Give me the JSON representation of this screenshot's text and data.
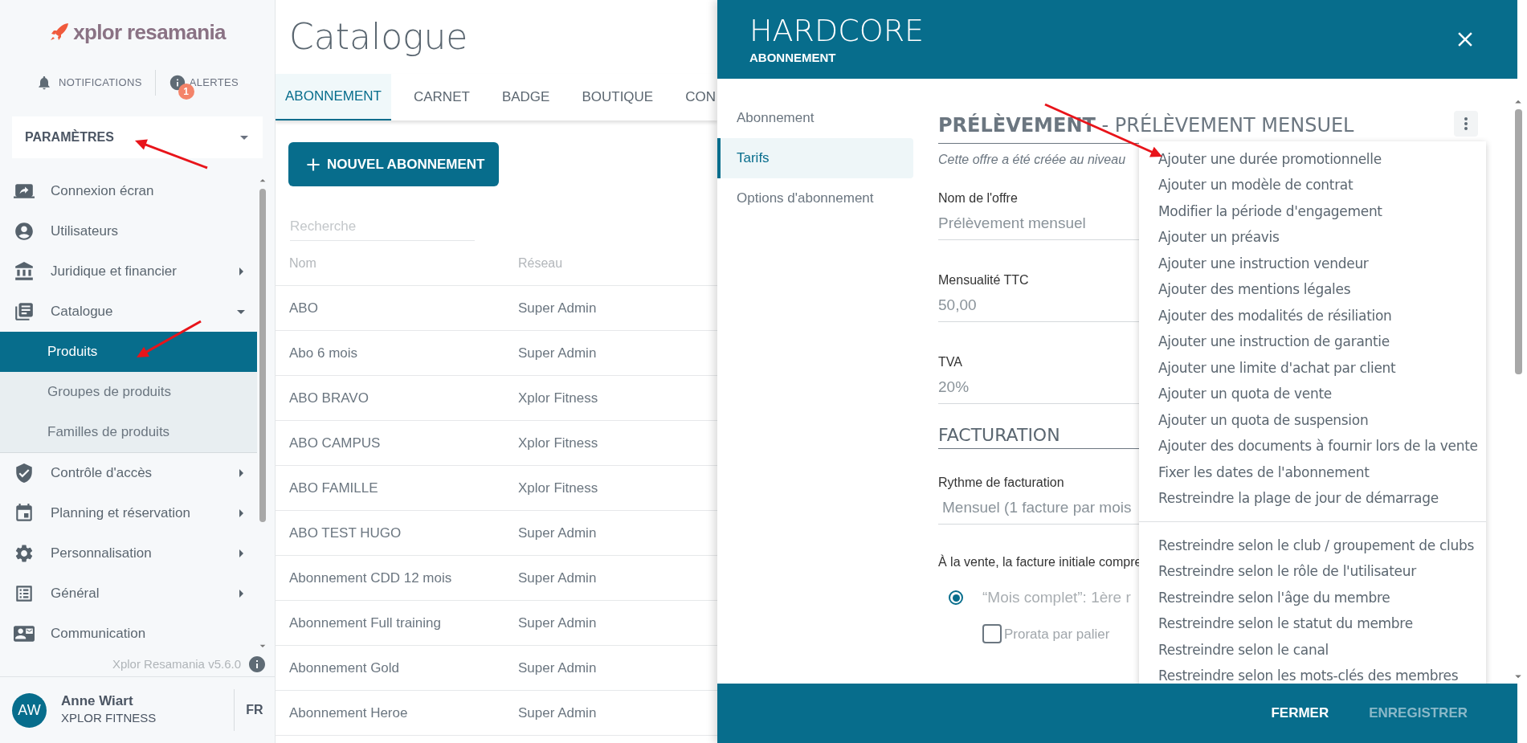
{
  "sidebar": {
    "logo": "xplor resamania",
    "notifications": {
      "label": "NOTIFICATIONS"
    },
    "alerts": {
      "label": "ALERTES",
      "count": "1"
    },
    "section_select": {
      "value": "PARAMÈTRES"
    },
    "items": [
      {
        "label": "Connexion écran"
      },
      {
        "label": "Utilisateurs"
      },
      {
        "label": "Juridique et financier",
        "expanded": false
      },
      {
        "label": "Catalogue",
        "expanded": true,
        "children": [
          {
            "label": "Produits",
            "selected": true
          },
          {
            "label": "Groupes de produits",
            "selected": false
          },
          {
            "label": "Familles de produits",
            "selected": false
          }
        ]
      },
      {
        "label": "Contrôle d'accès",
        "expanded": false
      },
      {
        "label": "Planning et réservation",
        "expanded": false
      },
      {
        "label": "Personnalisation",
        "expanded": false
      },
      {
        "label": "Général",
        "expanded": false
      },
      {
        "label": "Communication"
      }
    ],
    "version": "Xplor Resamania v5.6.0",
    "user": {
      "initials": "AW",
      "name": "Anne Wiart",
      "organization": "XPLOR FITNESS",
      "language": "FR"
    }
  },
  "main": {
    "title": "Catalogue",
    "tabs": [
      {
        "label": "ABONNEMENT",
        "selected": true
      },
      {
        "label": "CARNET",
        "selected": false
      },
      {
        "label": "BADGE",
        "selected": false
      },
      {
        "label": "BOUTIQUE",
        "selected": false
      },
      {
        "label": "CON",
        "selected": false
      }
    ],
    "new_button": "NOUVEL ABONNEMENT",
    "search": {
      "placeholder": "Recherche"
    },
    "table": {
      "columns": [
        "Nom",
        "Réseau"
      ],
      "rows": [
        [
          "ABO",
          "Super Admin"
        ],
        [
          "Abo 6 mois",
          "Super Admin"
        ],
        [
          "ABO BRAVO",
          "Xplor Fitness"
        ],
        [
          "ABO CAMPUS",
          "Xplor Fitness"
        ],
        [
          "ABO FAMILLE",
          "Xplor Fitness"
        ],
        [
          "ABO TEST HUGO",
          "Super Admin"
        ],
        [
          "Abonnement CDD 12 mois",
          "Super Admin"
        ],
        [
          "Abonnement Full training",
          "Super Admin"
        ],
        [
          "Abonnement Gold",
          "Super Admin"
        ],
        [
          "Abonnement Heroe",
          "Super Admin"
        ]
      ]
    }
  },
  "panel": {
    "title": "HARDCORE",
    "subtitle": "ABONNEMENT",
    "nav": [
      {
        "label": "Abonnement",
        "selected": false
      },
      {
        "label": "Tarifs",
        "selected": true
      },
      {
        "label": "Options d'abonnement",
        "selected": false
      }
    ],
    "heading": "**PRÉLÈVEMENT** - PRÉLÈVEMENT MENSUEL",
    "note": "Cette offre a été créée au niveau",
    "fields": [
      {
        "label": "Nom de l'offre",
        "value": "Prélèvement mensuel"
      },
      {
        "label": "Mensualité TTC",
        "value": "50,00"
      },
      {
        "label": "TVA",
        "value": "20%"
      }
    ],
    "billing": {
      "heading": "FACTURATION",
      "label": "Rythme de facturation",
      "value": "Mensuel (1 facture par mois",
      "invoice_label": "À la vente, la facture initiale compre",
      "option": {
        "label": "“Mois complet”: 1ère r",
        "selected": true
      },
      "prorata": {
        "label": "Prorata par palier",
        "checked": false
      }
    },
    "menu": {
      "groups": [
        [
          "Ajouter une durée promotionnelle",
          "Ajouter un modèle de contrat",
          "Modifier la période d'engagement",
          "Ajouter un préavis",
          "Ajouter une instruction vendeur",
          "Ajouter des mentions légales",
          "Ajouter des modalités de résiliation",
          "Ajouter une instruction de garantie",
          "Ajouter une limite d'achat par client",
          "Ajouter un quota de vente",
          "Ajouter un quota de suspension",
          "Ajouter des documents à fournir lors de la vente",
          "Fixer les dates de l'abonnement",
          "Restreindre la plage de jour de démarrage"
        ],
        [
          "Restreindre selon le club / groupement de clubs",
          "Restreindre selon le rôle de l'utilisateur",
          "Restreindre selon l'âge du membre",
          "Restreindre selon le statut du membre",
          "Restreindre selon le canal",
          "Restreindre selon les mots-clés des membres"
        ]
      ]
    },
    "footer": {
      "close": "FERMER",
      "save": "ENREGISTRER"
    }
  }
}
